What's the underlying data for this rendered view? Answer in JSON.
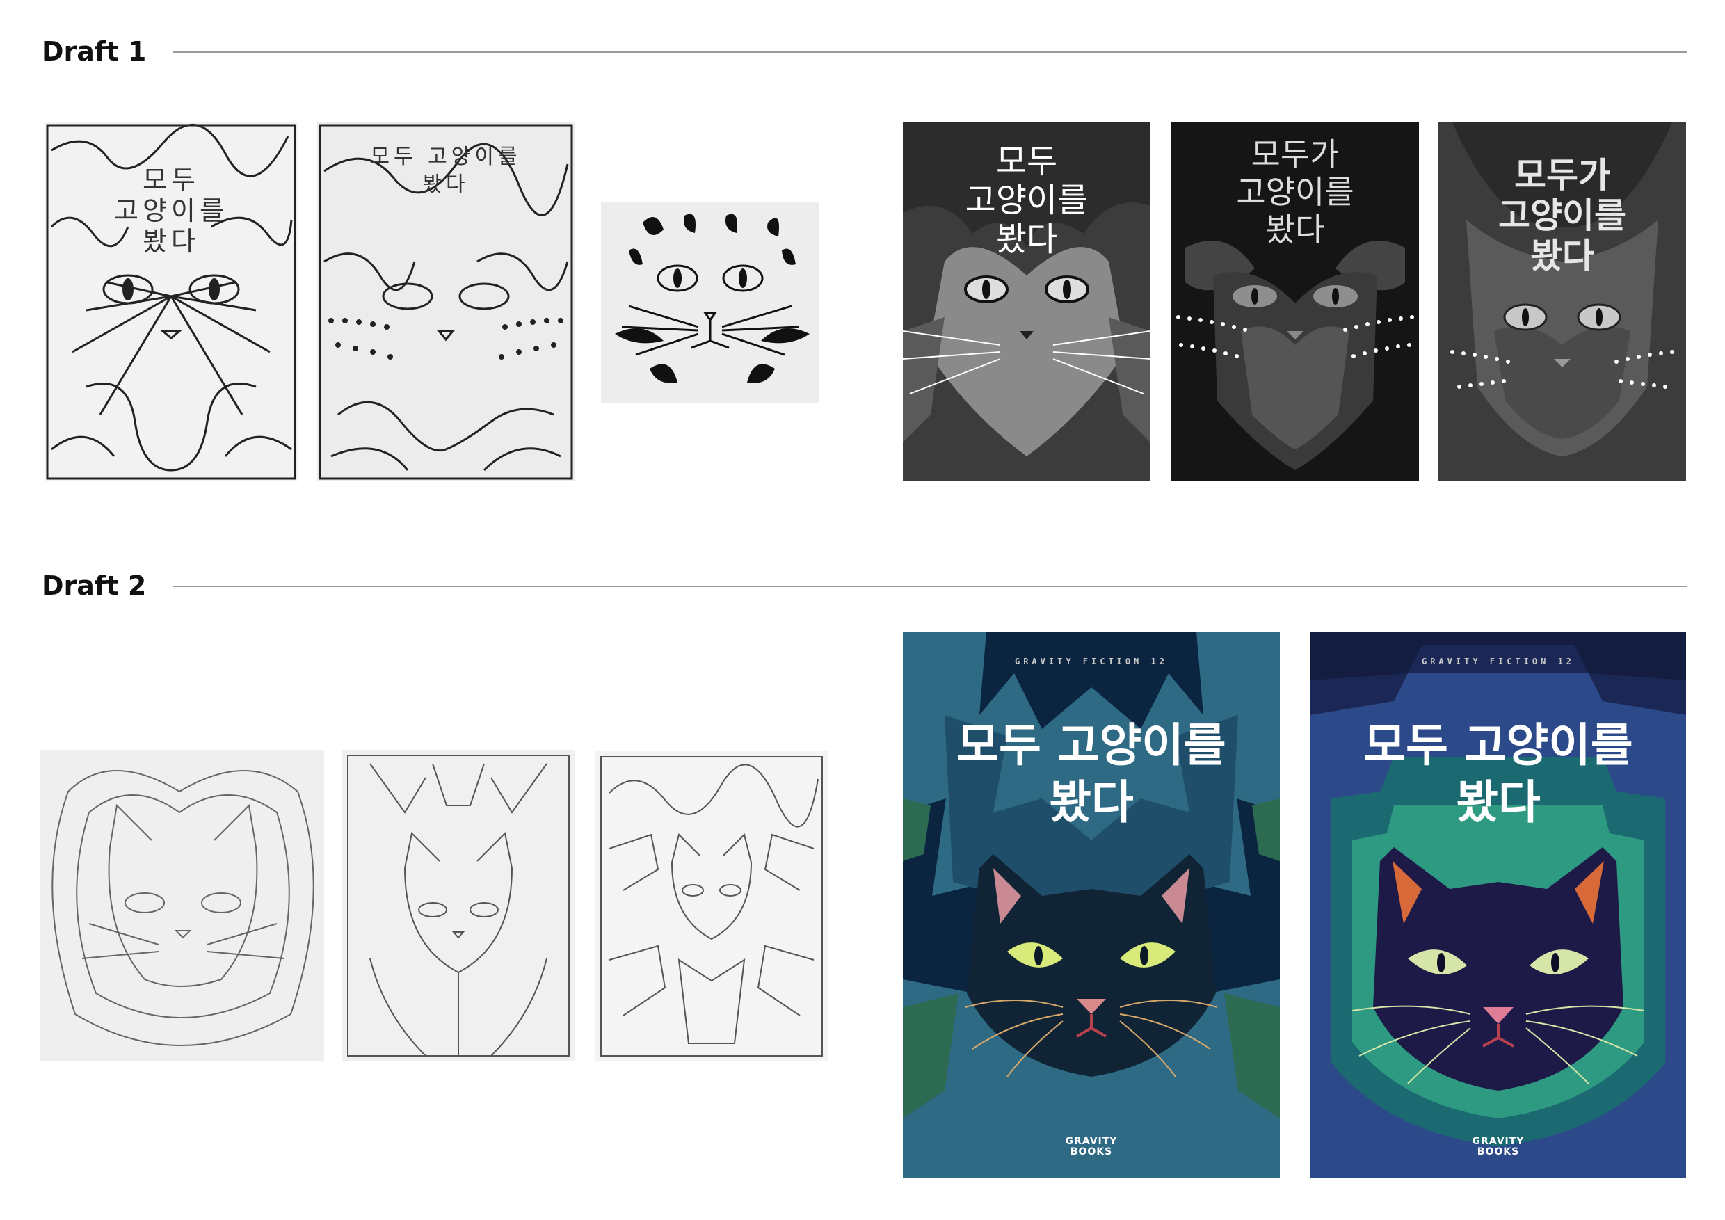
{
  "sections": [
    {
      "title": "Draft 1"
    },
    {
      "title": "Draft 2"
    }
  ],
  "draft1": {
    "sketch1_title": [
      "모두",
      "고양이를",
      "봤다"
    ],
    "sketch2_title": [
      "모두 고양이를",
      "봤다"
    ],
    "cover1_title": [
      "모두",
      "고양이를",
      "봤다"
    ],
    "cover2_title": [
      "모두가",
      "고양이를",
      "봤다"
    ],
    "cover3_title": [
      "모두가",
      "고양이를",
      "봤다"
    ]
  },
  "draft2": {
    "cover1": {
      "series": "GRAVITY FICTION 12",
      "title": [
        "모두 고양이를",
        "봤다"
      ],
      "publisher": [
        "GRAVITY",
        "BOOKS"
      ]
    },
    "cover2": {
      "series": "GRAVITY FICTION 12",
      "title": [
        "모두 고양이를",
        "봤다"
      ],
      "publisher": [
        "GRAVITY",
        "BOOKS"
      ]
    }
  },
  "colors": {
    "rule": "#9a9a9a",
    "cover_teal_bg": "#0c2a45",
    "cover_navy_bg": "#1c2a5c",
    "cat_eye": "#d8ea7a",
    "cat_nose": "#e0868e"
  }
}
